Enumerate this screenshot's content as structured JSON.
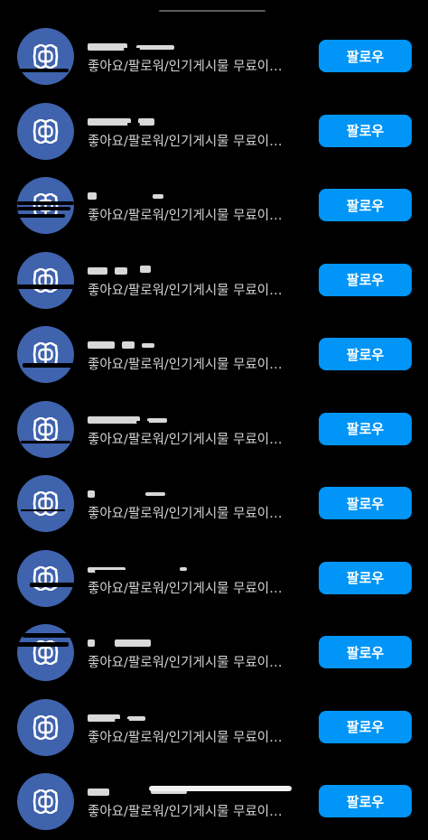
{
  "suggestions": [
    {
      "subtitle": "좋아요/팔로워/인기게시물 무료이…",
      "follow_label": "팔로우"
    },
    {
      "subtitle": "좋아요/팔로워/인기게시물 무료이…",
      "follow_label": "팔로우"
    },
    {
      "subtitle": "좋아요/팔로워/인기게시물 무료이…",
      "follow_label": "팔로우"
    },
    {
      "subtitle": "좋아요/팔로워/인기게시물 무료이…",
      "follow_label": "팔로우"
    },
    {
      "subtitle": "좋아요/팔로워/인기게시물 무료이…",
      "follow_label": "팔로우"
    },
    {
      "subtitle": "좋아요/팔로워/인기게시물 무료이…",
      "follow_label": "팔로우"
    },
    {
      "subtitle": "좋아요/팔로워/인기게시물 무료이…",
      "follow_label": "팔로우"
    },
    {
      "subtitle": "좋아요/팔로워/인기게시물 무료이…",
      "follow_label": "팔로우"
    },
    {
      "subtitle": "좋아요/팔로워/인기게시물 무료이…",
      "follow_label": "팔로우"
    },
    {
      "subtitle": "좋아요/팔로워/인기게시물 무료이…",
      "follow_label": "팔로우"
    },
    {
      "subtitle": "좋아요/팔로워/인기게시물 무료이…",
      "follow_label": "팔로우"
    }
  ],
  "colors": {
    "background": "#000000",
    "avatar": "#3f63ad",
    "follow_button": "#0095f6",
    "subtitle_text": "#d4d4d4"
  },
  "icons": {
    "avatar_logo": "interlocked-loops-logo-icon"
  }
}
